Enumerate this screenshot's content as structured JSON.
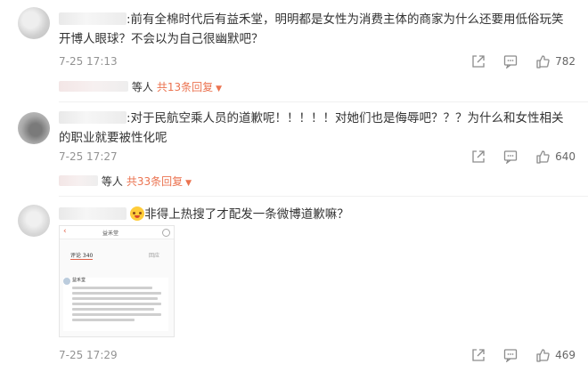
{
  "comments": [
    {
      "username": "",
      "text": ":前有全棉时代后有益禾堂，明明都是女性为消费主体的商家为什么还要用低俗玩笑开博人眼球？不会以为自己很幽默吧？",
      "time": "7-25 17:13",
      "like_count": "782",
      "replies": {
        "others_suffix": "等人",
        "more_label": "共13条回复"
      }
    },
    {
      "username": "",
      "text": ":对于民航空乘人员的道歉呢！！！！！对她们也是侮辱吧？？？为什么和女性相关的职业就要被性化呢",
      "time": "7-25 17:27",
      "like_count": "640",
      "replies": {
        "others_suffix": "等人",
        "more_label": "共33条回复"
      }
    },
    {
      "username": "",
      "text": "非得上热搜了才配发一条微博道歉嘛？",
      "time": "7-25 17:29",
      "like_count": "469",
      "attachment": {
        "account_name": "益禾堂",
        "tab_comments": "评论 340",
        "tab_right": "回应",
        "sender": "益禾堂",
        "back_glyph": "‹"
      }
    }
  ],
  "icons": [
    "share-icon",
    "comment-icon",
    "like-icon"
  ],
  "colors": {
    "accent": "#eb7350",
    "meta": "#939393",
    "text": "#333333"
  }
}
